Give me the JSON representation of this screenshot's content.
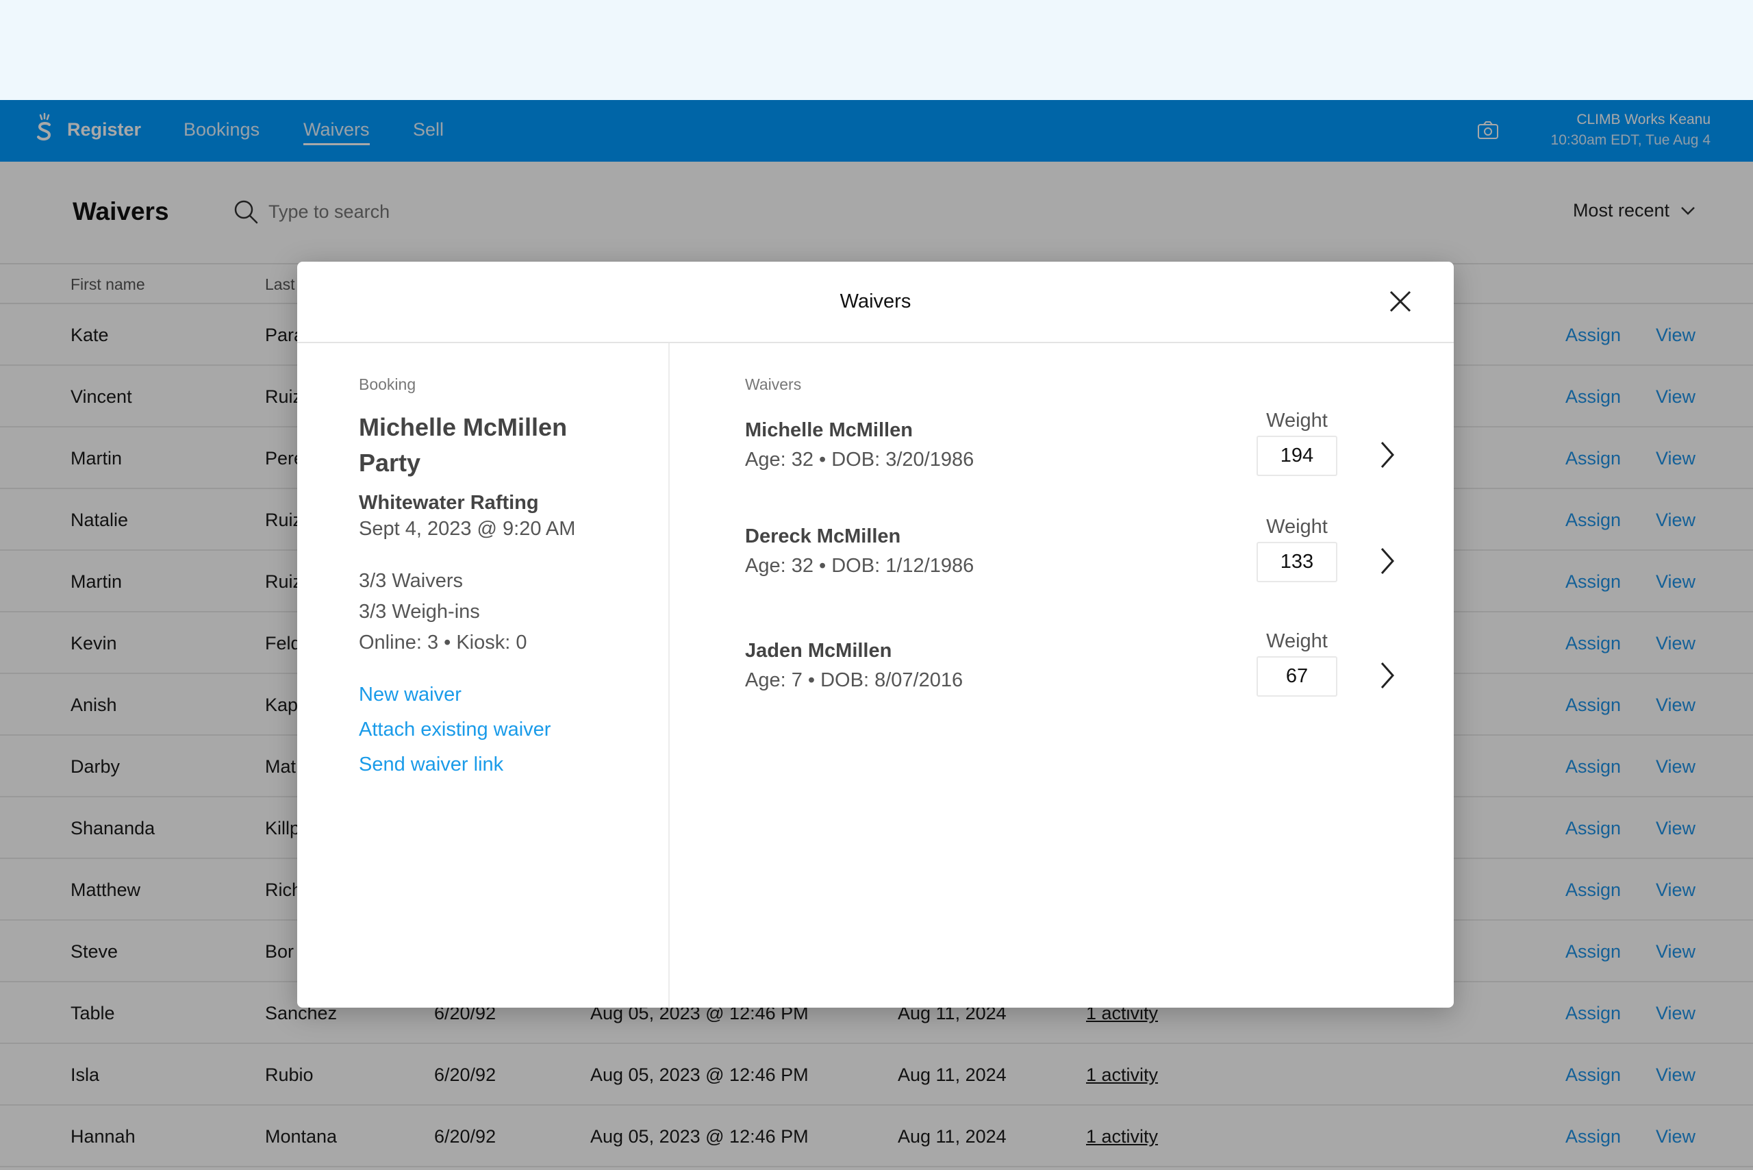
{
  "nav": {
    "brand": "Register",
    "items": [
      {
        "label": "Bookings"
      },
      {
        "label": "Waivers",
        "active": true
      },
      {
        "label": "Sell"
      }
    ],
    "account_name": "CLIMB Works Keanu",
    "account_time": "10:30am EDT, Tue Aug 4",
    "camera_icon": "camera-icon",
    "colors": {
      "header": "#0066aa",
      "link": "#1a9be9"
    }
  },
  "page": {
    "title": "Waivers",
    "search_placeholder": "Type to search",
    "sort_label": "Most recent"
  },
  "table": {
    "headers": [
      "First name",
      "Last"
    ],
    "rows": [
      {
        "first": "Kate",
        "last": "Para",
        "assign": "Assign",
        "view": "View"
      },
      {
        "first": "Vincent",
        "last": "Ruiz",
        "assign": "Assign",
        "view": "View"
      },
      {
        "first": "Martin",
        "last": "Pere",
        "assign": "Assign",
        "view": "View"
      },
      {
        "first": "Natalie",
        "last": "Ruiz",
        "assign": "Assign",
        "view": "View"
      },
      {
        "first": "Martin",
        "last": "Ruiz",
        "assign": "Assign",
        "view": "View"
      },
      {
        "first": "Kevin",
        "last": "Feld",
        "assign": "Assign",
        "view": "View"
      },
      {
        "first": "Anish",
        "last": "Kap",
        "assign": "Assign",
        "view": "View"
      },
      {
        "first": "Darby",
        "last": "Mat",
        "assign": "Assign",
        "view": "View"
      },
      {
        "first": "Shananda",
        "last": "Killp",
        "assign": "Assign",
        "view": "View"
      },
      {
        "first": "Matthew",
        "last": "Rich",
        "assign": "Assign",
        "view": "View"
      },
      {
        "first": "Steve",
        "last": "Bor",
        "assign": "Assign",
        "view": "View"
      },
      {
        "first": "Table",
        "last": "Sanchez",
        "dob": "6/20/92",
        "signed": "Aug 05, 2023 @ 12:46 PM",
        "expires": "Aug 11, 2024",
        "activity": "1 activity",
        "assign": "Assign",
        "view": "View"
      },
      {
        "first": "Isla",
        "last": "Rubio",
        "dob": "6/20/92",
        "signed": "Aug 05, 2023 @ 12:46 PM",
        "expires": "Aug 11, 2024",
        "activity": "1 activity",
        "assign": "Assign",
        "view": "View"
      },
      {
        "first": "Hannah",
        "last": "Montana",
        "dob": "6/20/92",
        "signed": "Aug 05, 2023 @ 12:46 PM",
        "expires": "Aug 11, 2024",
        "activity": "1 activity",
        "assign": "Assign",
        "view": "View"
      }
    ]
  },
  "modal": {
    "title": "Waivers",
    "booking_label": "Booking",
    "booking_name": "Michelle McMillen Party",
    "activity": "Whitewater Rafting",
    "activity_date": "Sept 4, 2023 @ 9:20 AM",
    "waivers_count": "3/3 Waivers",
    "weighins_count": "3/3 Weigh-ins",
    "sources": "Online: 3 • Kiosk: 0",
    "links": {
      "new": "New waiver",
      "attach": "Attach existing waiver",
      "send": "Send waiver link"
    },
    "waivers_label": "Waivers",
    "waivers": [
      {
        "name": "Michelle McMillen",
        "details": "Age: 32 • DOB: 3/20/1986",
        "weight_label": "Weight",
        "weight": "194"
      },
      {
        "name": "Dereck McMillen",
        "details": "Age: 32 • DOB: 1/12/1986",
        "weight_label": "Weight",
        "weight": "133"
      },
      {
        "name": "Jaden McMillen",
        "details": "Age: 7 • DOB: 8/07/2016",
        "weight_label": "Weight",
        "weight": "67"
      }
    ]
  }
}
